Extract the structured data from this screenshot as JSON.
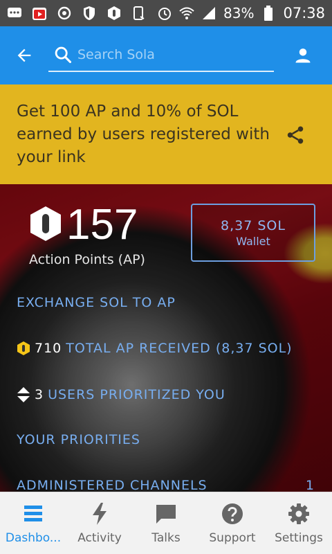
{
  "status_bar": {
    "battery": "83%",
    "time": "07:38"
  },
  "search": {
    "placeholder": "Search Sola"
  },
  "promo": {
    "text": "Get 100 AP and 10% of SOL earned by users registered with your link"
  },
  "points": {
    "value": "157",
    "label": "Action Points (AP)"
  },
  "wallet": {
    "amount": "8,37 SOL",
    "label": "Wallet"
  },
  "links": {
    "exchange": "EXCHANGE SOL TO AP",
    "total_ap_count": "710",
    "total_ap_text": "TOTAL AP RECEIVED (8,37 SOL)",
    "users_count": "3",
    "users_text": "USERS PRIORITIZED YOU",
    "priorities": "YOUR PRIORITIES",
    "channels": "ADMINISTERED CHANNELS",
    "channels_count": "1"
  },
  "nav": {
    "items": [
      {
        "label": "Dashbo...",
        "icon": "dashboard-icon"
      },
      {
        "label": "Activity",
        "icon": "lightning-icon"
      },
      {
        "label": "Talks",
        "icon": "chat-icon"
      },
      {
        "label": "Support",
        "icon": "help-icon"
      },
      {
        "label": "Settings",
        "icon": "gear-icon"
      }
    ]
  },
  "colors": {
    "primary": "#1f8fe8",
    "promo": "#e2b51f",
    "link": "#78aef0",
    "ap_badge": "#f5c518"
  }
}
